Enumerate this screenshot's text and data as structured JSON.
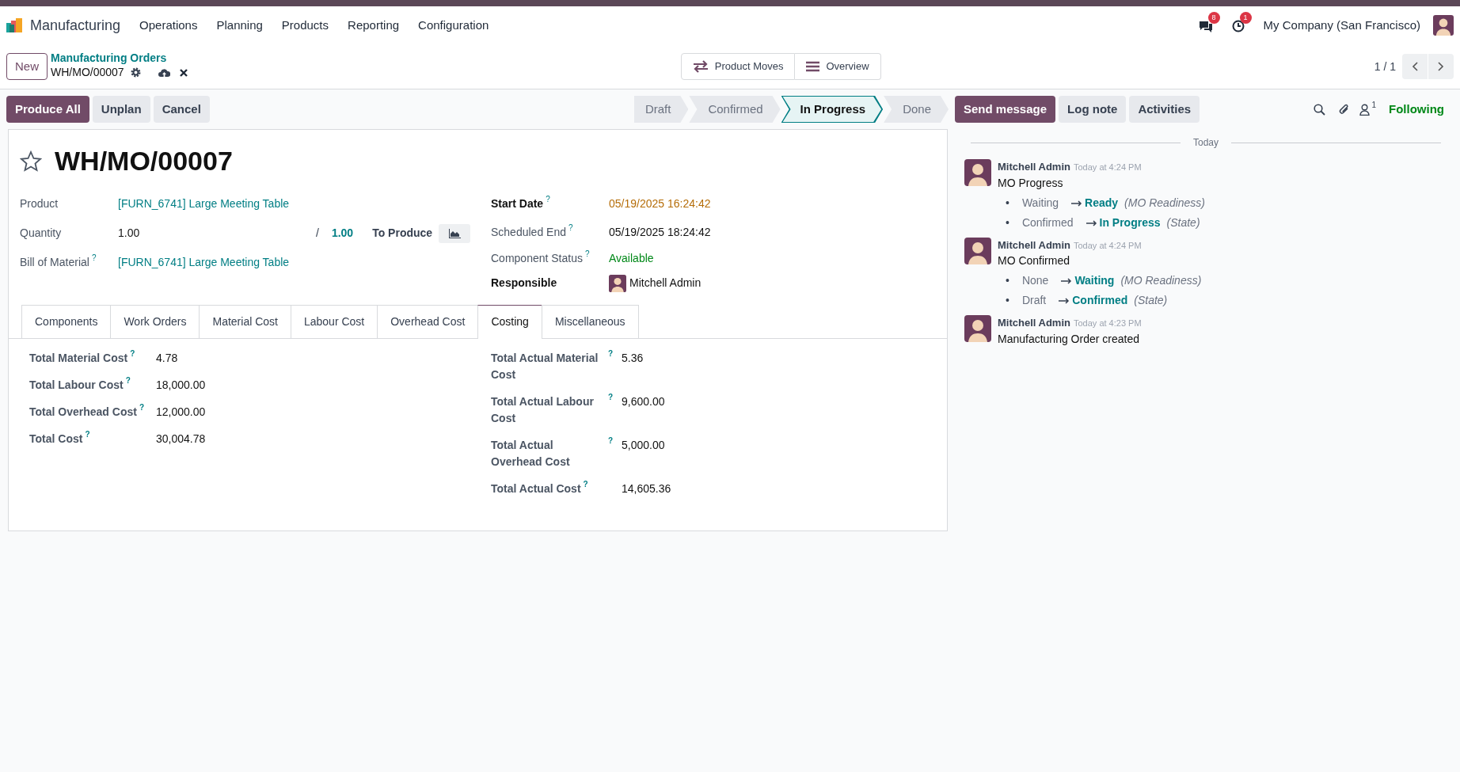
{
  "app": {
    "name": "Manufacturing",
    "menu": [
      "Operations",
      "Planning",
      "Products",
      "Reporting",
      "Configuration"
    ]
  },
  "systray": {
    "messages_badge": "8",
    "activities_badge": "1",
    "company": "My Company (San Francisco)"
  },
  "control_panel": {
    "new_button": "New",
    "breadcrumb": "Manufacturing Orders",
    "record": "WH/MO/00007",
    "smart_buttons": [
      {
        "label": "Product Moves",
        "kind": "moves"
      },
      {
        "label": "Overview",
        "kind": "menu"
      }
    ],
    "pager": "1 / 1"
  },
  "actions": [
    {
      "label": "Produce All",
      "kind": "primary"
    },
    {
      "label": "Unplan",
      "kind": "secondary"
    },
    {
      "label": "Cancel",
      "kind": "secondary"
    }
  ],
  "statusbar": [
    {
      "label": "Draft",
      "selected": false
    },
    {
      "label": "Confirmed",
      "selected": false
    },
    {
      "label": "In Progress",
      "selected": true
    },
    {
      "label": "Done",
      "selected": false
    }
  ],
  "chatter_buttons": [
    {
      "label": "Send message",
      "kind": "primary"
    },
    {
      "label": "Log note",
      "kind": "secondary"
    },
    {
      "label": "Activities",
      "kind": "secondary"
    }
  ],
  "followers": {
    "count": "1",
    "following": "Following"
  },
  "form": {
    "title": "WH/MO/00007",
    "starred": false,
    "left_fields": [
      {
        "label": "Product",
        "kind": "link",
        "value": "[FURN_6741] Large Meeting Table"
      },
      {
        "label": "Quantity",
        "kind": "quantity",
        "value": "1.00",
        "separator": "/",
        "target": "1.00",
        "suffix": "To Produce"
      },
      {
        "label": "Bill of Material",
        "help": "?",
        "kind": "link",
        "value": "[FURN_6741] Large Meeting Table"
      }
    ],
    "right_fields": [
      {
        "label": "Start Date",
        "help": "?",
        "strong": true,
        "kind": "text",
        "color": "#b56d08",
        "value": "05/19/2025 16:24:42"
      },
      {
        "label": "Scheduled End",
        "help": "?",
        "kind": "text",
        "value": "05/19/2025 18:24:42"
      },
      {
        "label": "Component Status",
        "help": "?",
        "kind": "text",
        "color": "#008818",
        "value": "Available"
      },
      {
        "label": "Responsible",
        "strong": true,
        "kind": "user",
        "value": "Mitchell Admin"
      }
    ],
    "tabs": [
      {
        "label": "Components",
        "selected": false
      },
      {
        "label": "Work Orders",
        "selected": false
      },
      {
        "label": "Material Cost",
        "selected": false
      },
      {
        "label": "Labour Cost",
        "selected": false
      },
      {
        "label": "Overhead Cost",
        "selected": false
      },
      {
        "label": "Costing",
        "selected": true
      },
      {
        "label": "Miscellaneous",
        "selected": false
      }
    ],
    "costing_left": [
      {
        "label": "Total Material Cost",
        "help": "?",
        "value": "4.78"
      },
      {
        "label": "Total Labour Cost",
        "help": "?",
        "value": "18,000.00"
      },
      {
        "label": "Total Overhead Cost",
        "help": "?",
        "value": "12,000.00"
      },
      {
        "label": "Total Cost",
        "help": "?",
        "value": "30,004.78"
      }
    ],
    "costing_right": [
      {
        "label": "Total Actual Material Cost",
        "help": "?",
        "value": "5.36"
      },
      {
        "label": "Total Actual Labour Cost",
        "help": "?",
        "value": "9,600.00"
      },
      {
        "label": "Total Actual Overhead Cost",
        "help": "?",
        "value": "5,000.00"
      },
      {
        "label": "Total Actual Cost",
        "help": "?",
        "value": "14,605.36"
      }
    ]
  },
  "chatter": {
    "divider": "Today",
    "messages": [
      {
        "author": "Mitchell Admin",
        "time": "Today at 4:24 PM",
        "body": "MO Progress",
        "changes": [
          {
            "bullet": "•",
            "old": "Waiting",
            "new": "Ready",
            "field": "(MO Readiness)"
          },
          {
            "bullet": "•",
            "old": "Confirmed",
            "new": "In Progress",
            "field": "(State)"
          }
        ]
      },
      {
        "author": "Mitchell Admin",
        "time": "Today at 4:24 PM",
        "body": "MO Confirmed",
        "changes": [
          {
            "bullet": "•",
            "old": "None",
            "new": "Waiting",
            "field": "(MO Readiness)"
          },
          {
            "bullet": "•",
            "old": "Draft",
            "new": "Confirmed",
            "field": "(State)"
          }
        ]
      },
      {
        "author": "Mitchell Admin",
        "time": "Today at 4:23 PM",
        "body": "Manufacturing Order created"
      }
    ]
  }
}
